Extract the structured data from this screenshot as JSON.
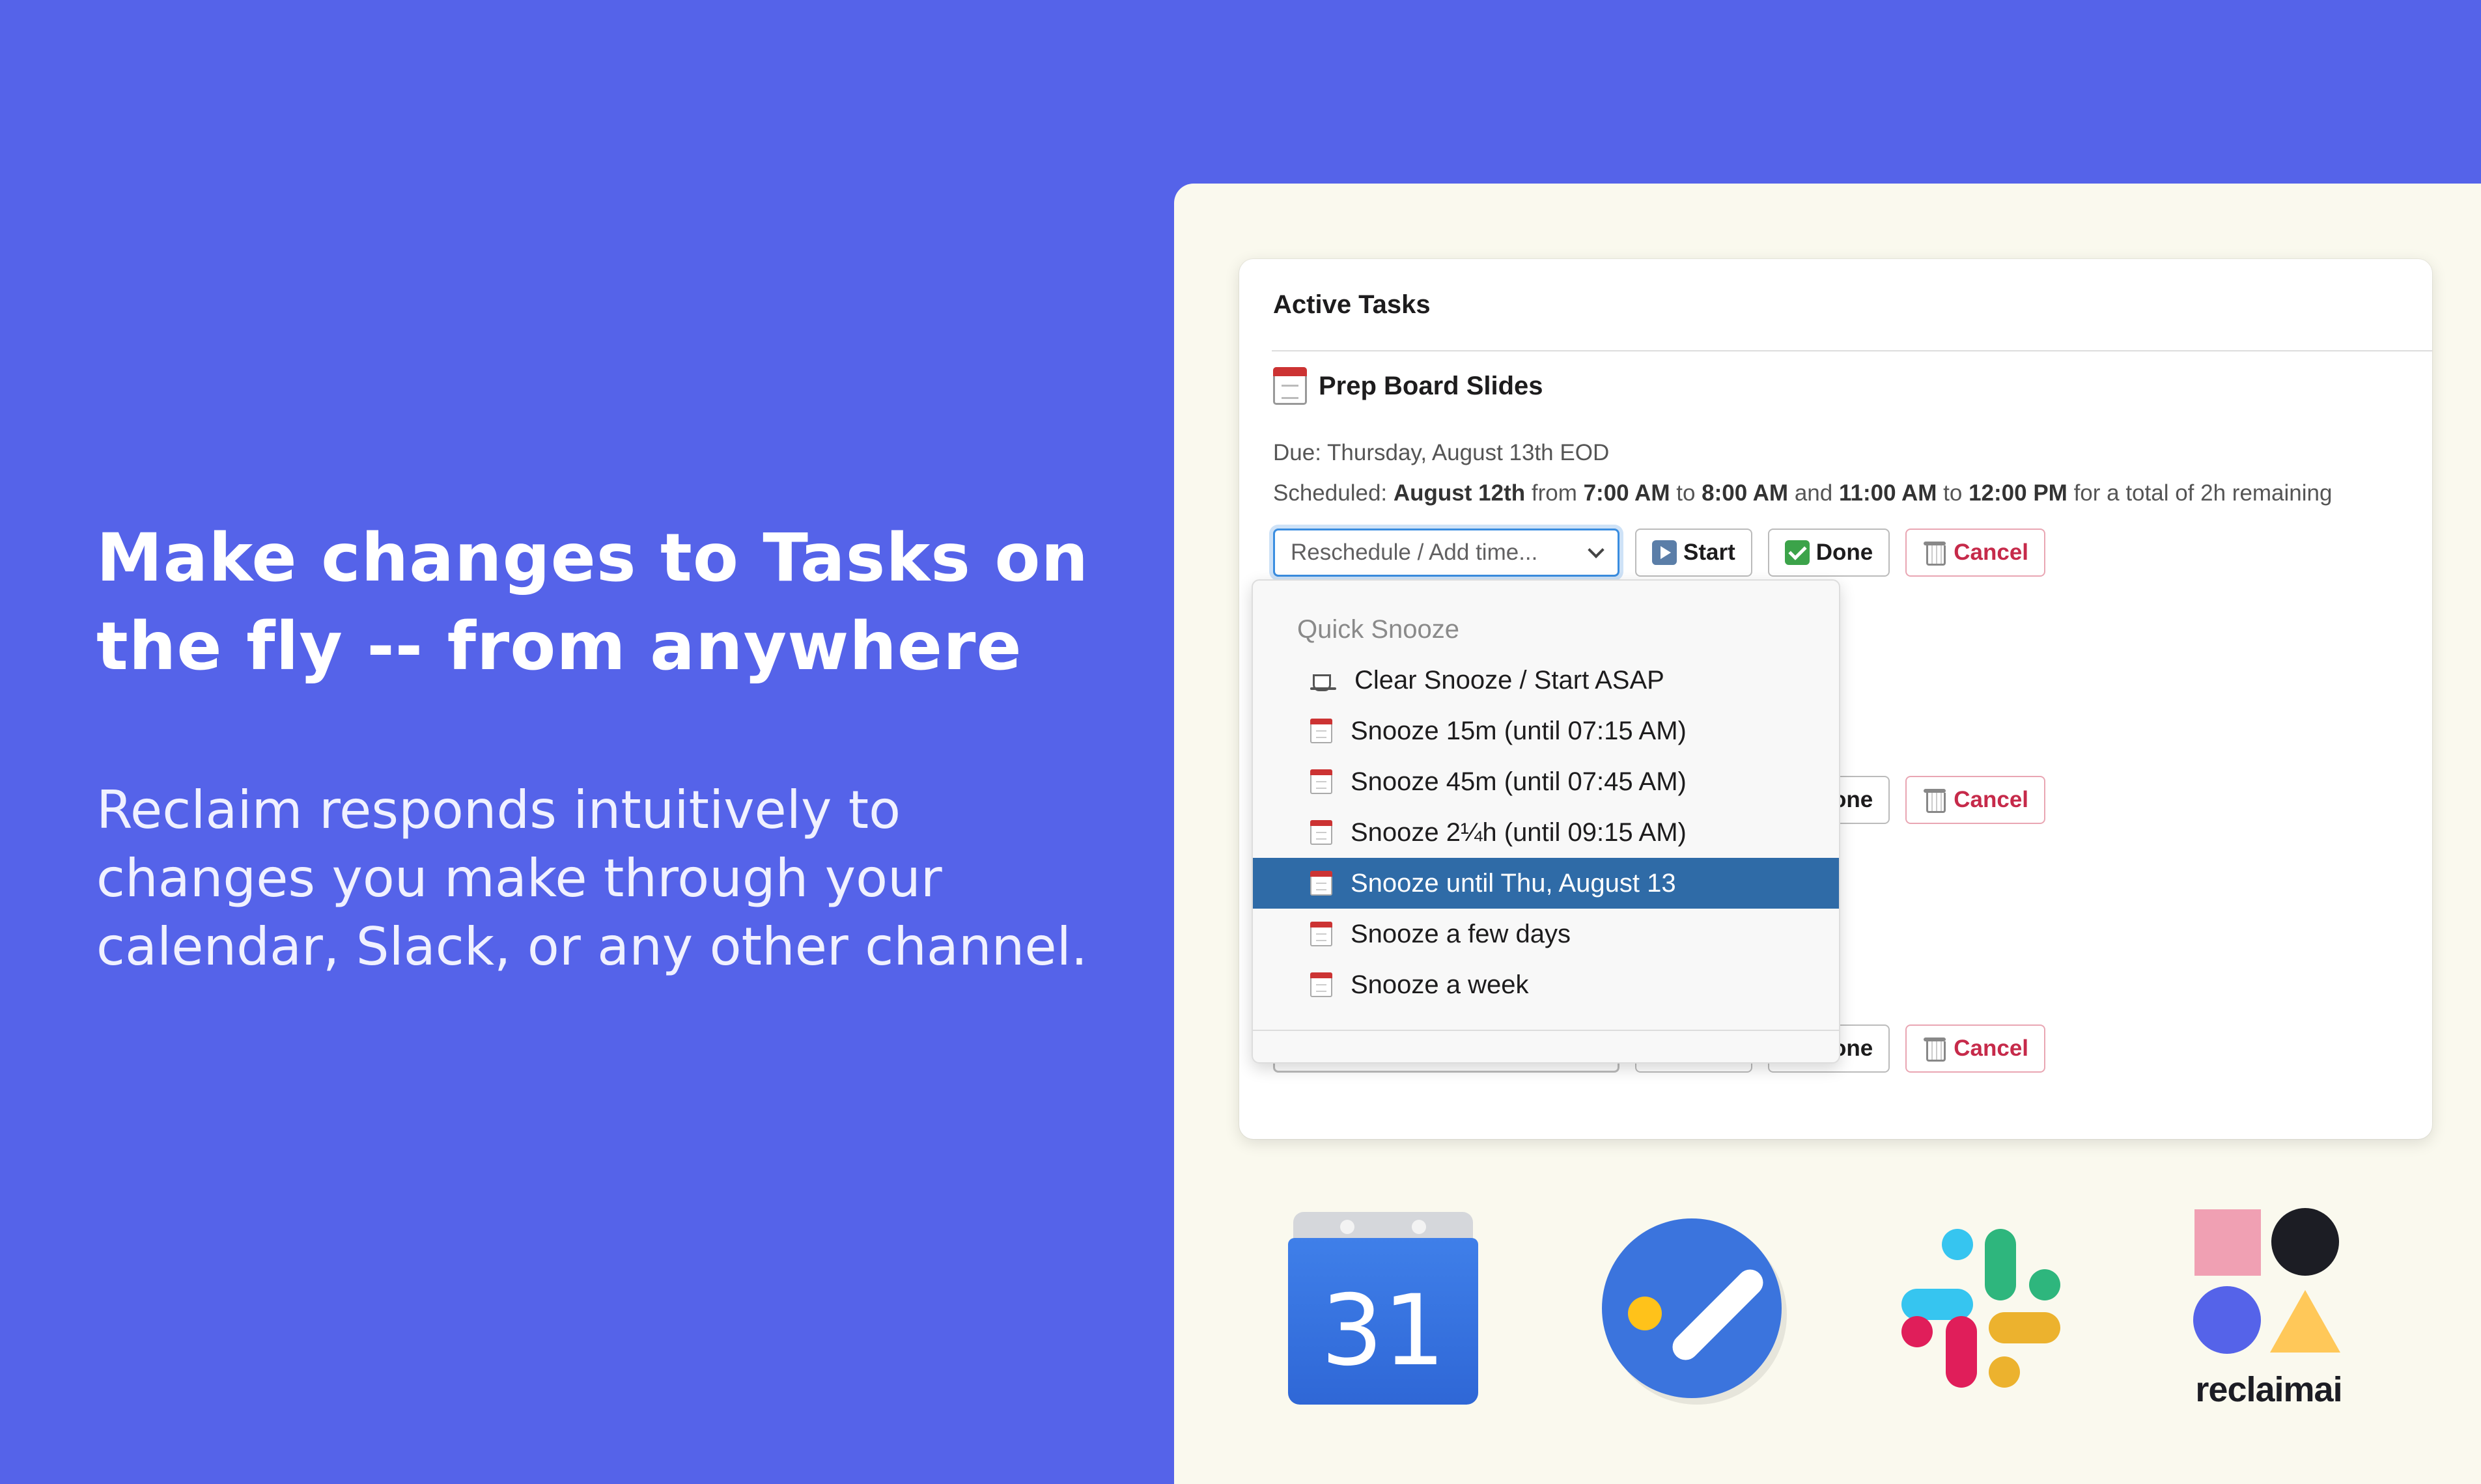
{
  "hero": {
    "title_line1": "Make changes to Tasks on",
    "title_line2": "the fly -- from anywhere",
    "subtitle_line1": "Reclaim responds intuitively to",
    "subtitle_line2": "changes you make through your",
    "subtitle_line3": "calendar, Slack, or any other channel."
  },
  "card": {
    "title": "Active Tasks",
    "task": {
      "name": "Prep Board Slides",
      "due": "Due: Thursday, August 13th EOD",
      "scheduled_prefix": "Scheduled:",
      "scheduled_date": "August 12th",
      "from": "from",
      "start1": "7:00 AM",
      "to": "to",
      "end1": "8:00 AM",
      "and": "and",
      "start2": "11:00 AM",
      "end2": "12:00 PM",
      "suffix": "for a total of 2h remaining"
    },
    "actions": {
      "select_placeholder": "Reschedule / Add time...",
      "start": "Start",
      "done": "Done",
      "cancel": "Cancel"
    }
  },
  "dropdown": {
    "header": "Quick Snooze",
    "items": [
      {
        "label": "Clear Snooze / Start ASAP",
        "icon": "coffee-icon"
      },
      {
        "label": "Snooze 15m (until 07:15 AM)",
        "icon": "calendar-icon"
      },
      {
        "label": "Snooze 45m (until 07:45 AM)",
        "icon": "calendar-icon"
      },
      {
        "label": "Snooze 2¼h (until 09:15 AM)",
        "icon": "calendar-icon"
      },
      {
        "label": "Snooze until Thu, August 13",
        "icon": "calendar-icon",
        "selected": true
      },
      {
        "label": "Snooze a few days",
        "icon": "calendar-icon"
      },
      {
        "label": "Snooze a week",
        "icon": "calendar-icon"
      }
    ]
  },
  "logos": {
    "google_calendar_number": "31",
    "reclaim_wordmark": "reclaimai"
  },
  "colors": {
    "background": "#5563E9",
    "panel": "#FAF9EE",
    "selected_item": "#2F6BA7",
    "cancel_text": "#C62A4A"
  }
}
